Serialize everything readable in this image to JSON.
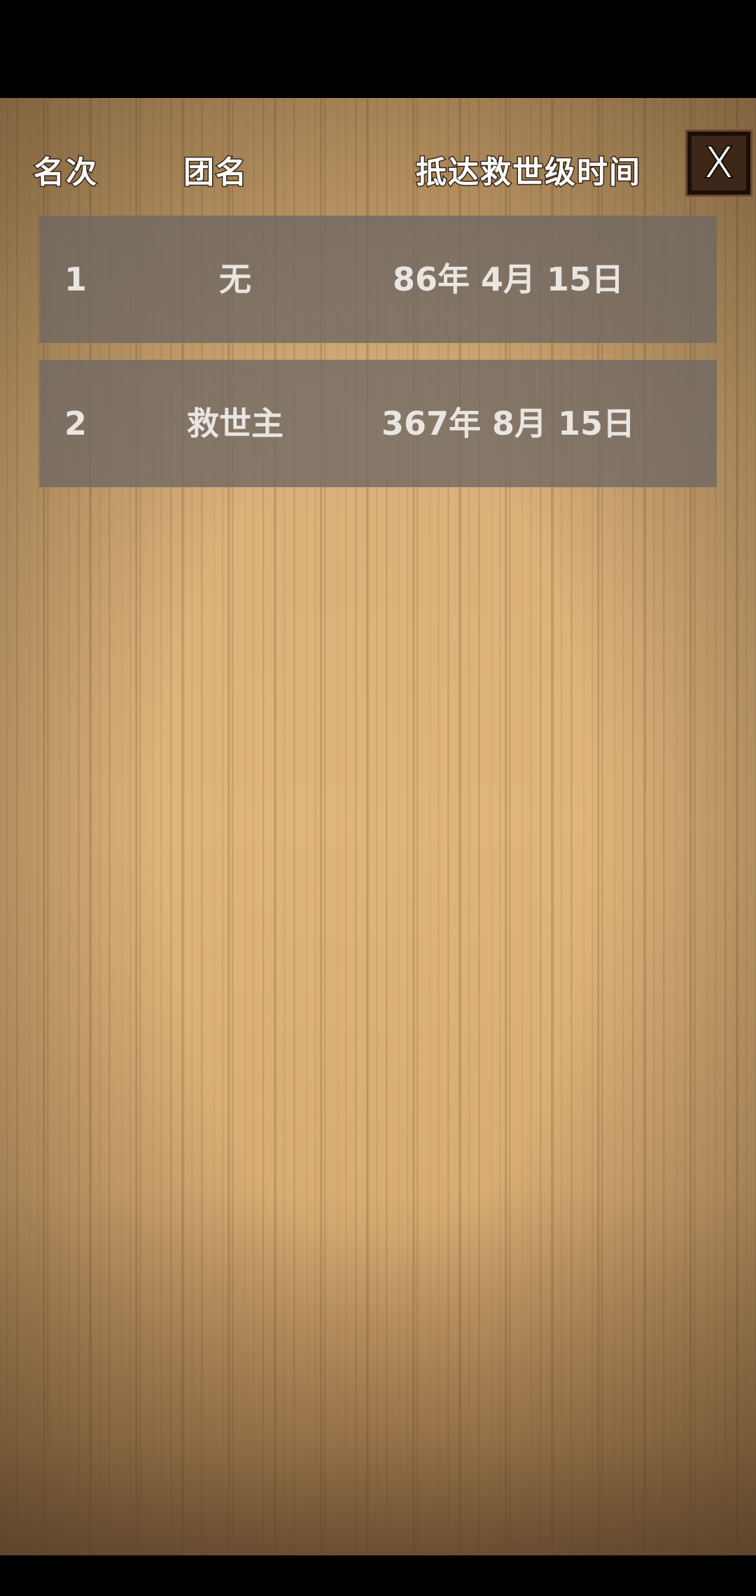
{
  "header": {
    "rank_label": "名次",
    "team_label": "团名",
    "time_label": "抵达救世级时间",
    "close_label": "X"
  },
  "rows": [
    {
      "rank": "1",
      "team": "无",
      "time": "86年 4月 15日"
    },
    {
      "rank": "2",
      "team": "救世主",
      "time": "367年 8月 15日"
    }
  ],
  "colors": {
    "row_background": "#6e6864",
    "text": "#e9e5e1",
    "close_button_bg": "#3e2618",
    "panel_wood": "#dfb57b"
  }
}
